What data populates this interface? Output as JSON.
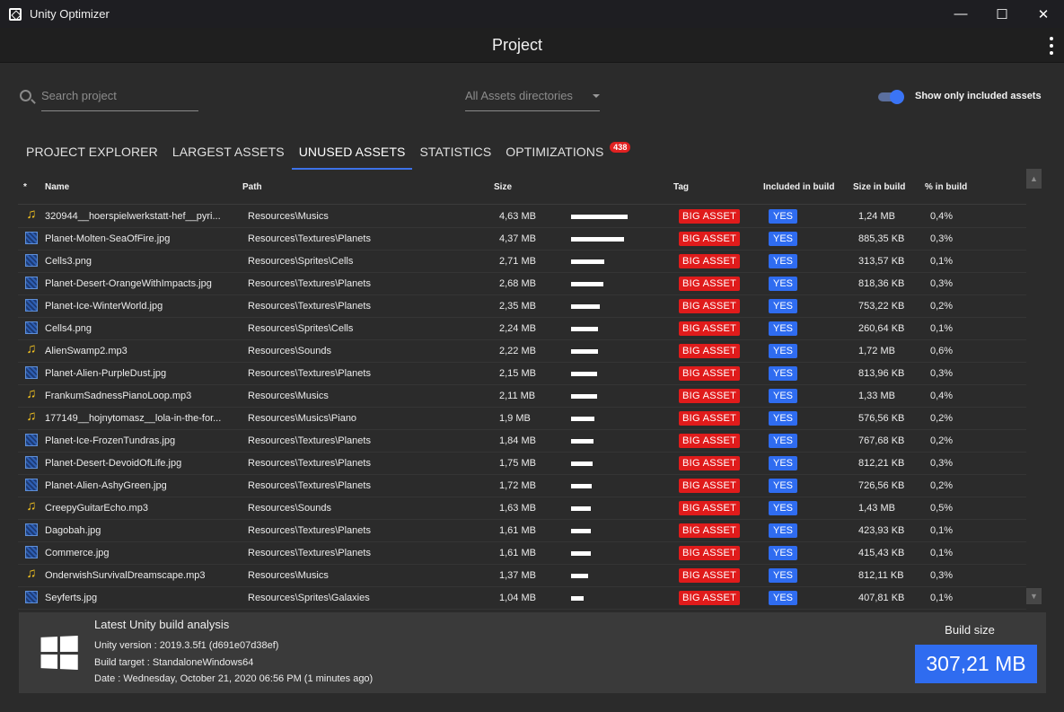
{
  "window": {
    "title": "Unity Optimizer",
    "controls": [
      "—",
      "☐",
      "✕"
    ]
  },
  "header": {
    "title": "Project"
  },
  "search": {
    "placeholder": "Search project"
  },
  "directory_dropdown": {
    "value": "All Assets directories"
  },
  "toggle": {
    "label": "Show only included assets",
    "on": true
  },
  "tabs": [
    {
      "label": "PROJECT EXPLORER"
    },
    {
      "label": "LARGEST ASSETS"
    },
    {
      "label": "UNUSED ASSETS",
      "active": true
    },
    {
      "label": "STATISTICS"
    },
    {
      "label": "OPTIMIZATIONS",
      "badge": "438"
    }
  ],
  "table": {
    "columns": {
      "sort": "*",
      "name": "Name",
      "path": "Path",
      "size": "Size",
      "tag": "Tag",
      "included": "Included in build",
      "size_in_build": "Size in build",
      "pct_in_build": "% in build"
    },
    "rows": [
      {
        "icon": "music",
        "name": "320944__hoerspielwerkstatt-hef__pyri...",
        "path": "Resources\\Musics",
        "size": "4,63 MB",
        "size_mb": 4.63,
        "tag": "BIG ASSET",
        "included": "YES",
        "size_in_build": "1,24 MB",
        "pct": "0,4%"
      },
      {
        "icon": "image",
        "name": "Planet-Molten-SeaOfFire.jpg",
        "path": "Resources\\Textures\\Planets",
        "size": "4,37 MB",
        "size_mb": 4.37,
        "tag": "BIG ASSET",
        "included": "YES",
        "size_in_build": "885,35 KB",
        "pct": "0,3%"
      },
      {
        "icon": "image",
        "name": "Cells3.png",
        "path": "Resources\\Sprites\\Cells",
        "size": "2,71 MB",
        "size_mb": 2.71,
        "tag": "BIG ASSET",
        "included": "YES",
        "size_in_build": "313,57 KB",
        "pct": "0,1%"
      },
      {
        "icon": "image",
        "name": "Planet-Desert-OrangeWithImpacts.jpg",
        "path": "Resources\\Textures\\Planets",
        "size": "2,68 MB",
        "size_mb": 2.68,
        "tag": "BIG ASSET",
        "included": "YES",
        "size_in_build": "818,36 KB",
        "pct": "0,3%"
      },
      {
        "icon": "image",
        "name": "Planet-Ice-WinterWorld.jpg",
        "path": "Resources\\Textures\\Planets",
        "size": "2,35 MB",
        "size_mb": 2.35,
        "tag": "BIG ASSET",
        "included": "YES",
        "size_in_build": "753,22 KB",
        "pct": "0,2%"
      },
      {
        "icon": "image",
        "name": "Cells4.png",
        "path": "Resources\\Sprites\\Cells",
        "size": "2,24 MB",
        "size_mb": 2.24,
        "tag": "BIG ASSET",
        "included": "YES",
        "size_in_build": "260,64 KB",
        "pct": "0,1%"
      },
      {
        "icon": "music",
        "name": "AlienSwamp2.mp3",
        "path": "Resources\\Sounds",
        "size": "2,22 MB",
        "size_mb": 2.22,
        "tag": "BIG ASSET",
        "included": "YES",
        "size_in_build": "1,72 MB",
        "pct": "0,6%"
      },
      {
        "icon": "image",
        "name": "Planet-Alien-PurpleDust.jpg",
        "path": "Resources\\Textures\\Planets",
        "size": "2,15 MB",
        "size_mb": 2.15,
        "tag": "BIG ASSET",
        "included": "YES",
        "size_in_build": "813,96 KB",
        "pct": "0,3%"
      },
      {
        "icon": "music",
        "name": "FrankumSadnessPianoLoop.mp3",
        "path": "Resources\\Musics",
        "size": "2,11 MB",
        "size_mb": 2.11,
        "tag": "BIG ASSET",
        "included": "YES",
        "size_in_build": "1,33 MB",
        "pct": "0,4%"
      },
      {
        "icon": "music",
        "name": "177149__hojnytomasz__lola-in-the-for...",
        "path": "Resources\\Musics\\Piano",
        "size": "1,9 MB",
        "size_mb": 1.9,
        "tag": "BIG ASSET",
        "included": "YES",
        "size_in_build": "576,56 KB",
        "pct": "0,2%"
      },
      {
        "icon": "image",
        "name": "Planet-Ice-FrozenTundras.jpg",
        "path": "Resources\\Textures\\Planets",
        "size": "1,84 MB",
        "size_mb": 1.84,
        "tag": "BIG ASSET",
        "included": "YES",
        "size_in_build": "767,68 KB",
        "pct": "0,2%"
      },
      {
        "icon": "image",
        "name": "Planet-Desert-DevoidOfLife.jpg",
        "path": "Resources\\Textures\\Planets",
        "size": "1,75 MB",
        "size_mb": 1.75,
        "tag": "BIG ASSET",
        "included": "YES",
        "size_in_build": "812,21 KB",
        "pct": "0,3%"
      },
      {
        "icon": "image",
        "name": "Planet-Alien-AshyGreen.jpg",
        "path": "Resources\\Textures\\Planets",
        "size": "1,72 MB",
        "size_mb": 1.72,
        "tag": "BIG ASSET",
        "included": "YES",
        "size_in_build": "726,56 KB",
        "pct": "0,2%"
      },
      {
        "icon": "music",
        "name": "CreepyGuitarEcho.mp3",
        "path": "Resources\\Sounds",
        "size": "1,63 MB",
        "size_mb": 1.63,
        "tag": "BIG ASSET",
        "included": "YES",
        "size_in_build": "1,43 MB",
        "pct": "0,5%"
      },
      {
        "icon": "image",
        "name": "Dagobah.jpg",
        "path": "Resources\\Textures\\Planets",
        "size": "1,61 MB",
        "size_mb": 1.61,
        "tag": "BIG ASSET",
        "included": "YES",
        "size_in_build": "423,93 KB",
        "pct": "0,1%"
      },
      {
        "icon": "image",
        "name": "Commerce.jpg",
        "path": "Resources\\Textures\\Planets",
        "size": "1,61 MB",
        "size_mb": 1.61,
        "tag": "BIG ASSET",
        "included": "YES",
        "size_in_build": "415,43 KB",
        "pct": "0,1%"
      },
      {
        "icon": "music",
        "name": "OnderwishSurvivalDreamscape.mp3",
        "path": "Resources\\Musics",
        "size": "1,37 MB",
        "size_mb": 1.37,
        "tag": "BIG ASSET",
        "included": "YES",
        "size_in_build": "812,11 KB",
        "pct": "0,3%"
      },
      {
        "icon": "image",
        "name": "Seyferts.jpg",
        "path": "Resources\\Sprites\\Galaxies",
        "size": "1,04 MB",
        "size_mb": 1.04,
        "tag": "BIG ASSET",
        "included": "YES",
        "size_in_build": "407,81 KB",
        "pct": "0,1%"
      }
    ]
  },
  "build": {
    "title": "Latest Unity build analysis",
    "unity_version": "Unity version : 2019.3.5f1 (d691e07d38ef)",
    "build_target": "Build target : StandaloneWindows64",
    "date": "Date : Wednesday, October 21, 2020 06:56 PM (1 minutes ago)",
    "size_label": "Build size",
    "size_value": "307,21 MB"
  },
  "colors": {
    "accent": "#3d72e8",
    "tag_red": "#e01b1b",
    "yes_blue": "#2f6cf0",
    "music_icon": "#f0c020"
  }
}
